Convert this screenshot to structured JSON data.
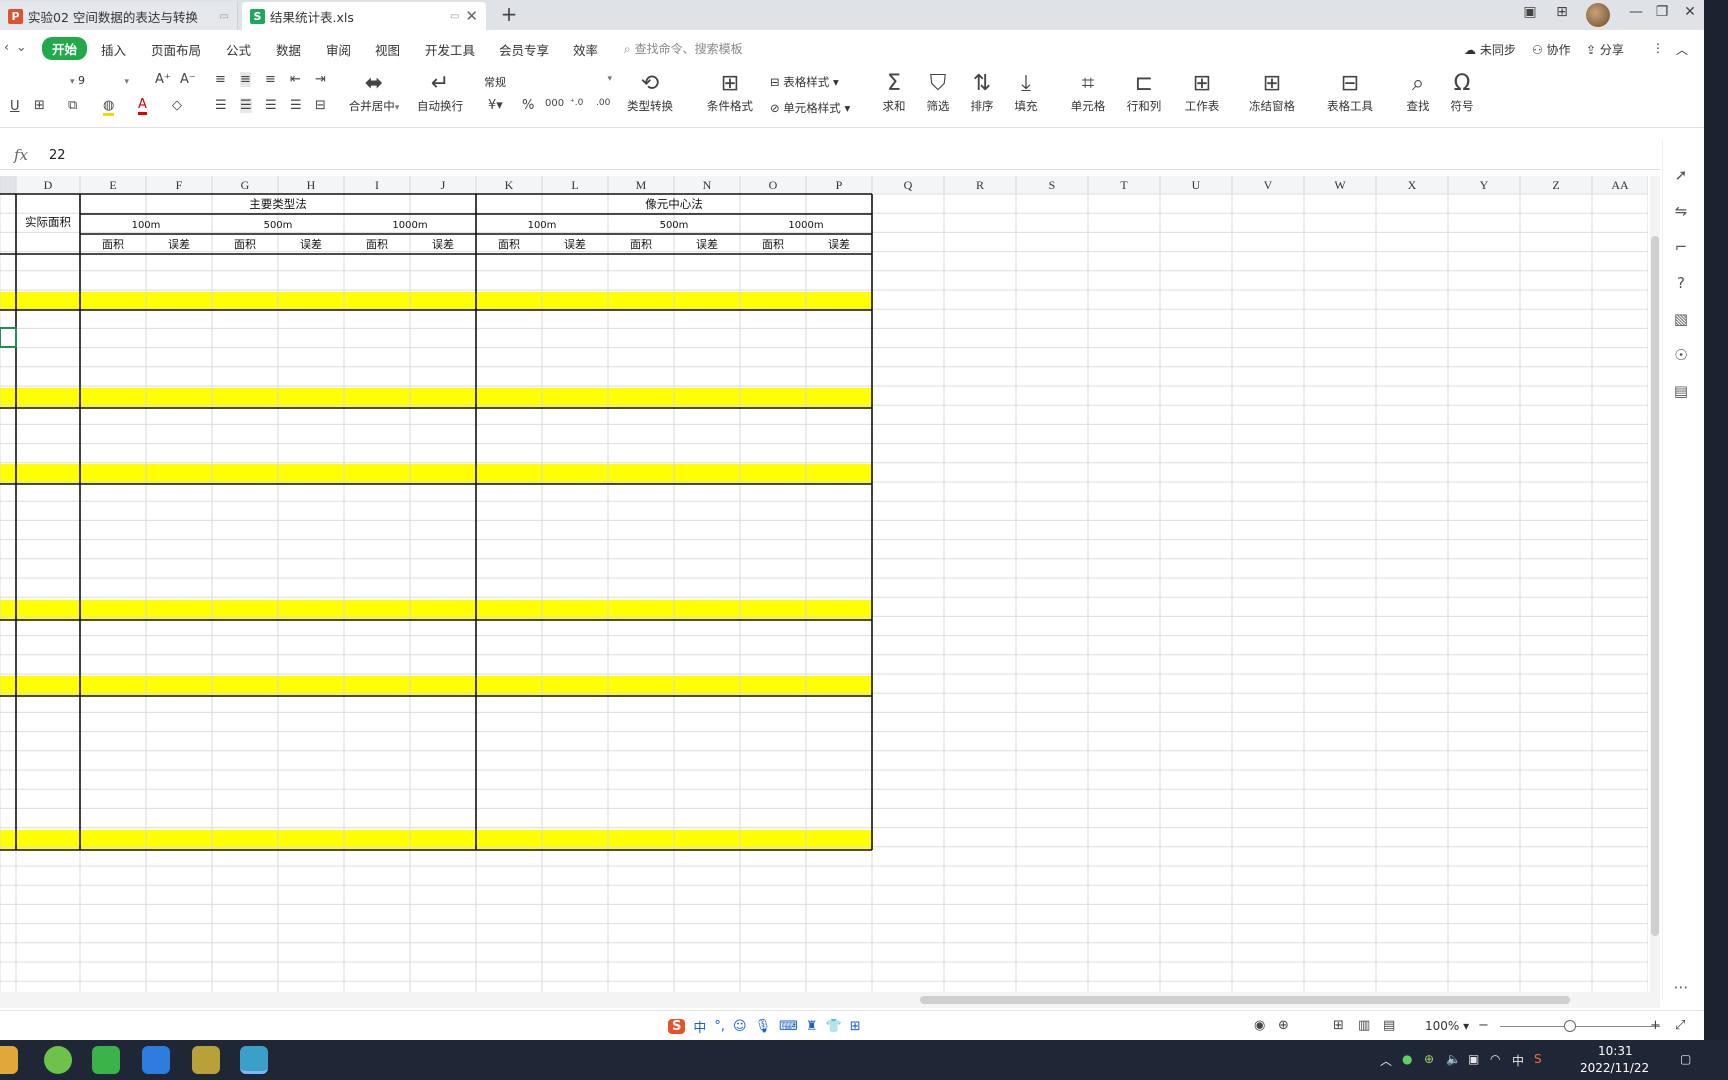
{
  "tabs": [
    {
      "title": "实验02 空间数据的表达与转换",
      "icon": "P",
      "icon_color": "#e0522b"
    },
    {
      "title": "结果统计表.xls",
      "icon": "S",
      "icon_color": "#1fa85a"
    }
  ],
  "menu": [
    "开始",
    "插入",
    "页面布局",
    "公式",
    "数据",
    "审阅",
    "视图",
    "开发工具",
    "会员专享",
    "效率"
  ],
  "search_placeholder": "查找命令、搜索模板",
  "top_actions": {
    "sync": "未同步",
    "collab": "协作",
    "share": "分享"
  },
  "ribbon": {
    "font_size": "9",
    "number_format": "常规",
    "merge_center": "合并居中",
    "wrap_text": "自动换行",
    "type_convert": "类型转换",
    "cond_format": "条件格式",
    "table_style": "表格样式",
    "cell_style": "单元格样式",
    "sum": "求和",
    "filter": "筛选",
    "sort": "排序",
    "fill": "填充",
    "cell": "单元格",
    "row_col": "行和列",
    "worksheet": "工作表",
    "freeze": "冻结窗格",
    "table_tools": "表格工具",
    "find": "查找",
    "symbol": "符号"
  },
  "formula_value": "22",
  "columns": [
    "D",
    "E",
    "F",
    "G",
    "H",
    "I",
    "J",
    "K",
    "L",
    "M",
    "N",
    "O",
    "P",
    "Q",
    "R",
    "S",
    "T",
    "U",
    "V",
    "W",
    "X",
    "Y",
    "Z",
    "AA"
  ],
  "table": {
    "actual_area": "实际面积",
    "method1": "主要类型法",
    "method2": "像元中心法",
    "resolutions": [
      "100m",
      "500m",
      "1000m"
    ],
    "area_label": "面积",
    "error_label": "误差"
  },
  "colors": {
    "highlight": "#ffff00",
    "accent": "#22a94a",
    "taskbar": "#1f2737"
  },
  "status": {
    "zoom": "100%"
  },
  "clock": {
    "time": "10:31",
    "date": "2022/11/22"
  },
  "ime": {
    "mode": "中"
  }
}
